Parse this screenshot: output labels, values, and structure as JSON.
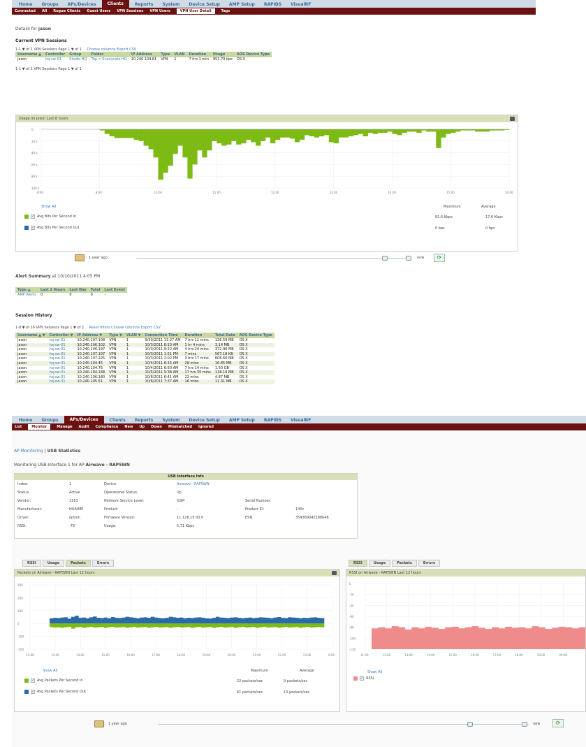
{
  "p1": {
    "nav": [
      "Home",
      "Groups",
      "APs/Devices",
      "Clients",
      "Reports",
      "System",
      "Device Setup",
      "AMP Setup",
      "RAPIDS",
      "VisualRF"
    ],
    "nav_active": 3,
    "subnav": [
      "Connected",
      "All",
      "Rogue Clients",
      "Guest Users",
      "VPN Sessions",
      "VPN Users",
      "VPN User Detail",
      "Tags"
    ],
    "subnav_active": 6,
    "details_label": "Details for",
    "details_user": "jason",
    "current_title": "Current VPN Sessions",
    "current_pager": "1-1 ▼ of 1 VPN Sessions  Page 1 ▼ of 1",
    "current_links": "Choose columns  Export CSV",
    "current_pager2": "1-1 ▼ of 1 VPN Sessions  Page 1 ▼ of 1",
    "current_headers": [
      "Username ▲",
      "Controller",
      "Group",
      "Folder",
      "IP Address",
      "Type",
      "VLAN",
      "Duration",
      "Usage",
      "AOS Device Type"
    ],
    "current_rows": [
      [
        "jason",
        "hq-sw-01",
        "Studio HQ",
        "Top > Sunnyvale HQ",
        "10.240.104.81",
        "VPN",
        "1",
        "7 hrs 1 min",
        "951.79 bps",
        "OS X"
      ]
    ],
    "chart_title": "Usage on jason  Last 8 hours",
    "yticks": [
      "0",
      "20 k",
      "40 k",
      "60 k",
      "80 k",
      "100 k"
    ],
    "xticks": [
      "8:00",
      "9:00",
      "10:00",
      "11:00",
      "12:00",
      "13:00",
      "14:00",
      "15:00",
      "16:00"
    ],
    "show_all": "Show All",
    "legend_hdr": [
      "Maximum",
      "Average"
    ],
    "legend": [
      {
        "name": "Avg Bits Per Second In",
        "color": "#7dbb14",
        "max": "81.6 Kbps",
        "avg": "17.6 Kbps"
      },
      {
        "name": "Avg Bits Per Second Out",
        "color": "#2a6aa8",
        "max": "0 bps",
        "avg": "0 bps"
      }
    ],
    "time_ago": "1 year ago",
    "time_now": "now",
    "alert_title": "Alert Summary",
    "alert_date": "at 10/10/2011 4:05 PM",
    "alert_headers": [
      "Type ▲",
      "Last 2 Hours",
      "Last Day",
      "Total",
      "Last Event"
    ],
    "alert_rows": [
      [
        "AMP Alerts",
        "0",
        "0",
        "0",
        "-"
      ]
    ],
    "history_title": "Session History",
    "history_pager": "1-8 ▼ of 16 VPN Sessions  Page 1 ▼ of 2",
    "history_links": "Reset filters  Choose columns  Export CSV",
    "history_headers": [
      "Username ▲ ▼",
      "Controller ▼",
      "IP Address ▼",
      "Type ▼",
      "VLAN ▼",
      "Connection Time",
      "Duration",
      "Total Data",
      "AOS Device Type"
    ],
    "history_rows": [
      [
        "jason",
        "hq-sw-01",
        "10.240.107.108",
        "VPN",
        "1",
        "9/30/2011 11:27 AM",
        "7 hrs 11 mins",
        "126.59 MB",
        "OS X"
      ],
      [
        "jason",
        "hq-sw-01",
        "10.240.106.102",
        "VPN",
        "1",
        "10/3/2011 8:13 AM",
        "1 hr 4 mins",
        "3.14 MB",
        "OS X"
      ],
      [
        "jason",
        "hq-sw-01",
        "10.240.106.197",
        "VPN",
        "1",
        "10/3/2011 9:22 AM",
        "4 hrs 24 mins",
        "372.96 MB",
        "OS X"
      ],
      [
        "jason",
        "hq-sw-01",
        "10.240.107.197",
        "VPN",
        "1",
        "10/3/2011 1:51 PM",
        "7 mins",
        "567.18 KB",
        "OS X"
      ],
      [
        "jason",
        "hq-sw-01",
        "10.240.107.225",
        "VPN",
        "1",
        "10/3/2011 2:02 PM",
        "3 hrs 17 mins",
        "608.66 MB",
        "OS X"
      ],
      [
        "jason",
        "hq-sw-01",
        "10.240.104.45",
        "VPN",
        "1",
        "10/4/2011 6:15 AM",
        "28 mins",
        "16.85 MB",
        "OS X"
      ],
      [
        "jason",
        "hq-sw-01",
        "10.240.104.76",
        "VPN",
        "1",
        "10/4/2011 6:50 AM",
        "7 hrs 14 mins",
        "1.50 GB",
        "OS X"
      ],
      [
        "jason",
        "hq-sw-01",
        "10.240.104.248",
        "VPN",
        "1",
        "10/5/2011 5:38 AM",
        "17 hrs 35 mins",
        "118.16 MB",
        "OS X"
      ],
      [
        "jason",
        "hq-sw-01",
        "10.240.106.180",
        "VPN",
        "1",
        "10/6/2011 6:41 AM",
        "22 mins",
        "4.87 MB",
        "OS X"
      ],
      [
        "jason",
        "hq-sw-01",
        "10.240.105.51",
        "VPN",
        "1",
        "10/6/2011 7:37 AM",
        "16 mins",
        "11.31 MB",
        "OS X"
      ]
    ]
  },
  "p2": {
    "nav": [
      "Home",
      "Groups",
      "APs/Devices",
      "Clients",
      "Reports",
      "System",
      "Device Setup",
      "AMP Setup",
      "RAPIDS",
      "VisualRF"
    ],
    "nav_active": 2,
    "subnav": [
      "List",
      "Monitor",
      "Manage",
      "Audit",
      "Compliance",
      "New",
      "Up",
      "Down",
      "Mismatched",
      "Ignored"
    ],
    "subnav_active": 1,
    "breadcrumb_link": "AP Monitoring",
    "breadcrumb_sep": " | ",
    "breadcrumb_current": "USB Statistics",
    "monitoring_text": "Monitoring USB Interface 1 for AP",
    "monitoring_ap": "Airwave - RAP5WN",
    "info_title": "USB Interface Info",
    "info": [
      {
        "k": "Index:",
        "v": "1",
        "k2": "Device:",
        "v2": "Airwave - RAP5WN",
        "k3": "",
        "v3": ""
      },
      {
        "k": "Status:",
        "v": "Active",
        "k2": "Operational Status:",
        "v2": "Up",
        "k3": "",
        "v3": ""
      },
      {
        "k": "Vendor:",
        "v": "1161",
        "k2": "Network Service Level:",
        "v2": "GSM",
        "k3": "Serial Number:",
        "v3": ""
      },
      {
        "k": "Manufacturer:",
        "v": "HUAWEI",
        "k2": "Product:",
        "v2": "-",
        "k3": "Product ID:",
        "v3": "140c"
      },
      {
        "k": "Driver:",
        "v": "option",
        "k2": "Firmware Version:",
        "v2": "11.126.15.00.0",
        "k3": "ESN:",
        "v3": "354369042188046"
      },
      {
        "k": "RSSI:",
        "v": "-79",
        "k2": "Usage:",
        "v2": "5.71 Kbps",
        "k3": "",
        "v3": ""
      }
    ],
    "tabs": [
      "RSSI",
      "Usage",
      "Packets",
      "Errors"
    ],
    "left_active": 2,
    "right_active": 0,
    "left_title": "Packets on Airwave - RAP5WN   Last 12 hours",
    "right_title": "RSSI on Airwave - RAP5WN   Last 12 hours",
    "left_yticks": [
      "300",
      "200",
      "100",
      "0",
      "-100",
      "-200"
    ],
    "left_xticks": [
      "12:00",
      "13:00",
      "14:00",
      "15:00",
      "16:00",
      "17:00",
      "18:00",
      "19:00",
      "20:00",
      "21:00",
      "22:00",
      "23:00",
      "0:00"
    ],
    "right_yticks": [
      "0",
      "-20",
      "-40",
      "-60",
      "-80",
      "-100",
      "-120"
    ],
    "right_xticks": [
      "11:00",
      "12:00",
      "13:00",
      "14:00",
      "15:00",
      "16:00",
      "17:00",
      "18:00",
      "19:00",
      "20:00"
    ],
    "show_all": "Show All",
    "legend_hdr": [
      "Maximum",
      "Average"
    ],
    "legend": [
      {
        "name": "Avg Packets Per Second In",
        "color": "#7dbb14",
        "max": "22 packets/sec",
        "avg": "9 packets/sec"
      },
      {
        "name": "Avg Packets Per Second Out",
        "color": "#2a6aa8",
        "max": "61 packets/sec",
        "avg": "13 packets/sec"
      }
    ],
    "rssi_legend": {
      "name": "RSSI",
      "color": "#f08b8b"
    },
    "time_ago": "1 year ago",
    "time_now": "now"
  },
  "chart_data": [
    {
      "type": "bar",
      "title": "Usage on jason  Last 8 hours",
      "series": [
        {
          "name": "Avg Bits Per Second In",
          "values": [
            0,
            0,
            0,
            0,
            0,
            0,
            0,
            0,
            0,
            0,
            0,
            0,
            2,
            8,
            12,
            15,
            15,
            15,
            15,
            18,
            20,
            28,
            34,
            48,
            86,
            74,
            62,
            42,
            28,
            48,
            84,
            60,
            36,
            48,
            36,
            20,
            24,
            28,
            26,
            20,
            26,
            24,
            18,
            22,
            28,
            20,
            14,
            24,
            18,
            14,
            14,
            16,
            22,
            18,
            10,
            12,
            14,
            12,
            10,
            22,
            24,
            14,
            14,
            12,
            10,
            8,
            12,
            6,
            8,
            6,
            6,
            4,
            8,
            10,
            6,
            4,
            4,
            6,
            2,
            4,
            4,
            32,
            14,
            8,
            6,
            4,
            2,
            2,
            2,
            4,
            4,
            4,
            2,
            2,
            2,
            1
          ]
        }
      ],
      "ylim": [
        0,
        100
      ]
    },
    {
      "type": "bar",
      "title": "Packets on Airwave - RAP5WN   Last 12 hours",
      "series": [
        {
          "name": "Avg Packets Per Second Out",
          "values": [
            40,
            44,
            42,
            46,
            48,
            38,
            52,
            60,
            44,
            46,
            40,
            48,
            54,
            44,
            42,
            46,
            40,
            50,
            44,
            42,
            46,
            52,
            48,
            44,
            40,
            46,
            48,
            44,
            52,
            46,
            42,
            40,
            44,
            52,
            48,
            44,
            46,
            40,
            44,
            42,
            46,
            48,
            44,
            40,
            38,
            44,
            52,
            46,
            44,
            42,
            46,
            48,
            44,
            40,
            44,
            46,
            42,
            44,
            48,
            46,
            44,
            40,
            46,
            50,
            44,
            42,
            48,
            46,
            44,
            40,
            44,
            42,
            46,
            48,
            44,
            42
          ]
        },
        {
          "name": "Avg Packets Per Second In",
          "values": [
            -28,
            -32,
            -30,
            -34,
            -30,
            -26,
            -40,
            -30,
            -28,
            -34,
            -30,
            -26,
            -32,
            -30,
            -28,
            -34,
            -30,
            -26,
            -32,
            -30,
            -28,
            -34,
            -30,
            -26,
            -32,
            -30,
            -28,
            -34,
            -30,
            -26,
            -32,
            -30,
            -28,
            -34,
            -30,
            -26,
            -32,
            -30,
            -28,
            -34,
            -30,
            -26,
            -32,
            -30,
            -28,
            -34,
            -30,
            -26,
            -32,
            -30,
            -28,
            -34,
            -30,
            -26,
            -32,
            -30,
            -28,
            -34,
            -30,
            -26,
            -32,
            -30,
            -28,
            -34,
            -30,
            -26,
            -32,
            -30,
            -28,
            -34,
            -30,
            -26,
            -32,
            -30,
            -28,
            -30
          ]
        }
      ],
      "ylim": [
        -200,
        300
      ]
    },
    {
      "type": "area",
      "title": "RSSI on Airwave - RAP5WN   Last 12 hours",
      "series": [
        {
          "name": "RSSI",
          "values": [
            -82,
            -80,
            -82,
            -78,
            -80,
            -84,
            -80,
            -82,
            -79,
            -81,
            -83,
            -80,
            -79,
            -82,
            -80,
            -78,
            -81,
            -83,
            -80,
            -82,
            -79,
            -81,
            -80,
            -82,
            -78,
            -80,
            -83,
            -81,
            -79,
            -80,
            -82,
            -80
          ]
        }
      ],
      "ylim": [
        -120,
        0
      ]
    }
  ]
}
